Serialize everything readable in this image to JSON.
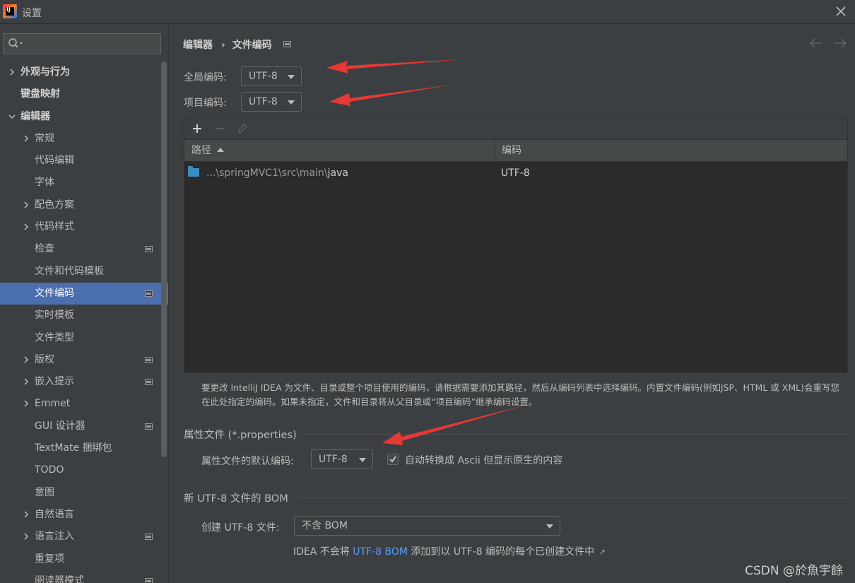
{
  "window": {
    "title": "设置",
    "logo_text": "IJ"
  },
  "sidebar": {
    "search_placeholder": "",
    "items": [
      {
        "label": "外观与行为",
        "level": 0,
        "expandable": true,
        "expanded": false,
        "bold": true
      },
      {
        "label": "键盘映射",
        "level": 0,
        "expandable": false,
        "bold": true
      },
      {
        "label": "编辑器",
        "level": 0,
        "expandable": true,
        "expanded": true,
        "bold": true
      },
      {
        "label": "常规",
        "level": 1,
        "expandable": true,
        "expanded": false
      },
      {
        "label": "代码编辑",
        "level": 1
      },
      {
        "label": "字体",
        "level": 1
      },
      {
        "label": "配色方案",
        "level": 1,
        "expandable": true,
        "expanded": false
      },
      {
        "label": "代码样式",
        "level": 1,
        "expandable": true,
        "expanded": false
      },
      {
        "label": "检查",
        "level": 1,
        "project": true
      },
      {
        "label": "文件和代码模板",
        "level": 1
      },
      {
        "label": "文件编码",
        "level": 1,
        "project": true,
        "selected": true
      },
      {
        "label": "实时模板",
        "level": 1
      },
      {
        "label": "文件类型",
        "level": 1
      },
      {
        "label": "版权",
        "level": 1,
        "expandable": true,
        "expanded": false,
        "project": true
      },
      {
        "label": "嵌入提示",
        "level": 1,
        "expandable": true,
        "expanded": false,
        "project": true
      },
      {
        "label": "Emmet",
        "level": 1,
        "expandable": true,
        "expanded": false
      },
      {
        "label": "GUI 设计器",
        "level": 1,
        "project": true
      },
      {
        "label": "TextMate 捆绑包",
        "level": 1
      },
      {
        "label": "TODO",
        "level": 1
      },
      {
        "label": "意图",
        "level": 1
      },
      {
        "label": "自然语言",
        "level": 1,
        "expandable": true,
        "expanded": false
      },
      {
        "label": "语言注入",
        "level": 1,
        "expandable": true,
        "expanded": false,
        "project": true
      },
      {
        "label": "重复项",
        "level": 1
      },
      {
        "label": "阅读器模式",
        "level": 1,
        "project": true
      }
    ]
  },
  "header": {
    "breadcrumb_parent": "编辑器",
    "breadcrumb_separator": "›",
    "breadcrumb_current": "文件编码"
  },
  "global_encoding": {
    "label": "全局编码:",
    "value": "UTF-8"
  },
  "project_encoding": {
    "label": "项目编码:",
    "value": "UTF-8"
  },
  "table": {
    "columns": [
      "路径",
      "编码"
    ],
    "sort_column": "路径",
    "sort_direction": "ascending",
    "rows": [
      {
        "path_prefix": "...\\springMVC1\\src\\main\\",
        "path_last": "java",
        "encoding": "UTF-8"
      }
    ]
  },
  "help_text": "要更改 IntelliJ IDEA 为文件、目录或整个项目使用的编码，请根据需要添加其路径，然后从编码列表中选择编码。内置文件编码(例如JSP、HTML 或 XML)会重写您在此处指定的编码。如果未指定，文件和目录将从父目录或“项目编码”继承编码设置。",
  "properties_section": {
    "title": "属性文件 (*.properties)",
    "default_label": "属性文件的默认编码:",
    "default_value": "UTF-8",
    "checkbox_checked": true,
    "checkbox_label": "自动转换成 Ascii 但显示原生的内容"
  },
  "bom_section": {
    "title": "新 UTF-8 文件的 BOM",
    "create_label": "创建 UTF-8 文件:",
    "create_value": "不含 BOM",
    "note_prefix": "IDEA 不会将 ",
    "note_link": "UTF-8 BOM",
    "note_suffix": " 添加到以 UTF-8 编码的每个已创建文件中",
    "note_ext_icon": "↗"
  },
  "watermark": "CSDN @於魚宇餘",
  "colors": {
    "background": "#3c3f41",
    "selection": "#4b6eaf",
    "link": "#589df6",
    "annotation_arrow": "#e53935",
    "folder": "#3c8ec2"
  }
}
